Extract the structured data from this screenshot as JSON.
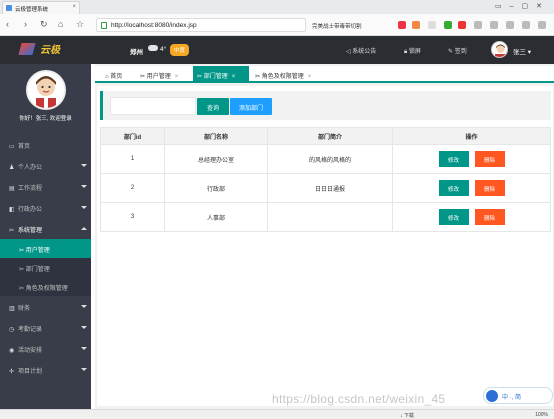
{
  "browser": {
    "tab_title": "云极管理系统",
    "url": "http://localhost:8080/index.jsp",
    "ad_text": "完美战士带毒带切割",
    "zoom": "100%",
    "downloads_label": "下载"
  },
  "header": {
    "logo_text": "云极",
    "city": "郑州",
    "temperature": "4°",
    "air_quality": "中度",
    "announcement": "系统公告",
    "lock": "锁屏",
    "checkin": "签到",
    "username": "张三"
  },
  "sidebar": {
    "welcome": "你好！张三, 欢迎登录",
    "items": [
      {
        "label": "首页",
        "icon": "monitor-icon"
      },
      {
        "label": "个人办公",
        "icon": "user-icon"
      },
      {
        "label": "工作流程",
        "icon": "workflow-icon"
      },
      {
        "label": "行政办公",
        "icon": "admin-icon"
      },
      {
        "label": "系统管理",
        "icon": "wrench-icon"
      },
      {
        "label": "用户管理",
        "icon": "wrench-icon"
      },
      {
        "label": "部门管理",
        "icon": "wrench-icon"
      },
      {
        "label": "角色及权限管理",
        "icon": "wrench-icon"
      },
      {
        "label": "财务",
        "icon": "finance-icon"
      },
      {
        "label": "考勤记录",
        "icon": "clock-icon"
      },
      {
        "label": "活动安排",
        "icon": "activity-icon"
      },
      {
        "label": "项目计划",
        "icon": "plan-icon"
      }
    ]
  },
  "tabs": [
    {
      "label": "首页"
    },
    {
      "label": "用户管理"
    },
    {
      "label": "部门管理"
    },
    {
      "label": "角色及权限管理"
    }
  ],
  "toolbar": {
    "query_label": "查询",
    "add_label": "添加部门"
  },
  "table": {
    "headers": [
      "部门id",
      "部门名称",
      "部门简介",
      "操作"
    ],
    "rows": [
      {
        "id": "1",
        "name": "总经理办公室",
        "intro": "的风格的风格的"
      },
      {
        "id": "2",
        "name": "行政部",
        "intro": "日日日通报"
      },
      {
        "id": "3",
        "name": "人事部",
        "intro": ""
      }
    ],
    "edit_label": "修改",
    "delete_label": "删除"
  },
  "watermark": "https://blog.csdn.net/weixin_45",
  "floatbar_text": "中 ·, 简",
  "colors": {
    "accent": "#009688",
    "blue": "#1e9fff",
    "danger": "#ff5722",
    "sidebar": "#393d49",
    "header": "#2a2d32"
  }
}
